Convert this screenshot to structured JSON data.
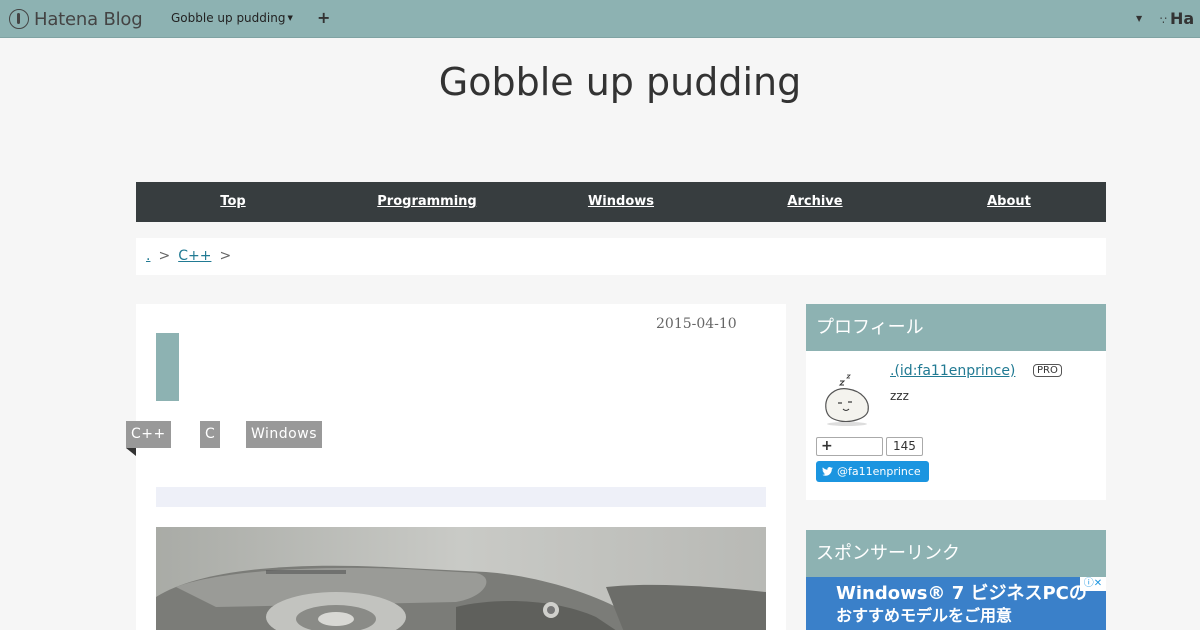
{
  "header": {
    "logo_text": "Hatena Blog",
    "blog_menu_label": "Gobble up pudding",
    "add_label": "+",
    "right_logo_text": "Ha"
  },
  "blog": {
    "title": "Gobble up pudding"
  },
  "nav": {
    "items": [
      "Top",
      "Programming",
      "Windows",
      "Archive",
      "About"
    ]
  },
  "breadcrumb": {
    "home_label": ".",
    "category_label": "C++",
    "separator": ">"
  },
  "entry": {
    "date": "2015-04-10",
    "categories": [
      "C++",
      "C",
      "Windows"
    ]
  },
  "sidebar": {
    "profile": {
      "title": "プロフィール",
      "id_label": ".(id:fa11enprince)",
      "pro_badge": "PRO",
      "description": "zzz",
      "subscribe_label": "+",
      "subscribe_count": "145",
      "twitter_label": "@fa11enprince"
    },
    "ad_module": {
      "title": "スポンサーリンク",
      "ad_line1": "Windows® 7 ビジネスPCの",
      "ad_line2": "おすすめモデルをご用意",
      "ad_icons": "ⓘ✕"
    }
  },
  "colors": {
    "accent": "#8db2b2",
    "nav_bg": "#373d3f",
    "link": "#217a93",
    "category_bg": "#999999",
    "twitter": "#1b95e0"
  }
}
